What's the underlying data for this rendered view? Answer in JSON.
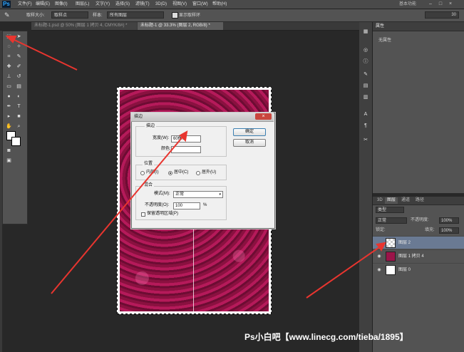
{
  "menubar": {
    "logo": "Ps",
    "items": [
      "文件(F)",
      "编辑(E)",
      "图像(I)",
      "图层(L)",
      "文字(Y)",
      "选择(S)",
      "滤镜(T)",
      "3D(D)",
      "视图(V)",
      "窗口(W)",
      "帮助(H)"
    ],
    "workspace": "基本功能",
    "window_controls": [
      "–",
      "□",
      "×"
    ]
  },
  "options": {
    "brush_size_label": "取样大小:",
    "brush_size_value": "取样点",
    "sample_label": "样本:",
    "sample_value": "所有图层",
    "show_ring_label": "显示取样环",
    "right_value": "30"
  },
  "tabs": [
    {
      "label": "未标题-1.psd @ 50% (图层 1 拷贝 4, CMYK/8#) *"
    },
    {
      "label": "未标题-1 @ 33.3% (图层 2, RGB/8) *"
    }
  ],
  "properties": {
    "tab": "属性",
    "empty_text": "无属性"
  },
  "layers_panel": {
    "tabs": [
      "3D",
      "图层",
      "通道",
      "路径"
    ],
    "kind_select": "类型",
    "mode_select": "正常",
    "opacity_label": "不透明度:",
    "opacity_value": "100%",
    "lock_label": "锁定:",
    "fill_label": "填充:",
    "fill_value": "100%",
    "layers": [
      {
        "name": "图层 2",
        "selected": true
      },
      {
        "name": "图层 1 拷贝 4",
        "selected": false
      },
      {
        "name": "图层 0",
        "selected": false
      }
    ]
  },
  "dialog": {
    "title": "描边",
    "stroke_group": "描边",
    "width_label": "宽度(W):",
    "width_value": "60像素",
    "color_label": "颜色:",
    "ok": "确定",
    "cancel": "取消",
    "position_group": "位置",
    "positions": [
      "内部(I)",
      "居中(C)",
      "居外(U)"
    ],
    "selected_position": 1,
    "blend_group": "混合",
    "mode_label": "模式(M):",
    "mode_value": "正常",
    "opacity_label": "不透明度(O):",
    "opacity_value": "100",
    "opacity_unit": "%",
    "preserve_label": "保留透明区域(P)"
  },
  "watermark": "Ps小白吧【www.linecg.com/tieba/1895】",
  "colors": {
    "accent": "#31a8ff",
    "arrow": "#e8352f",
    "petals": "#9b1449"
  }
}
